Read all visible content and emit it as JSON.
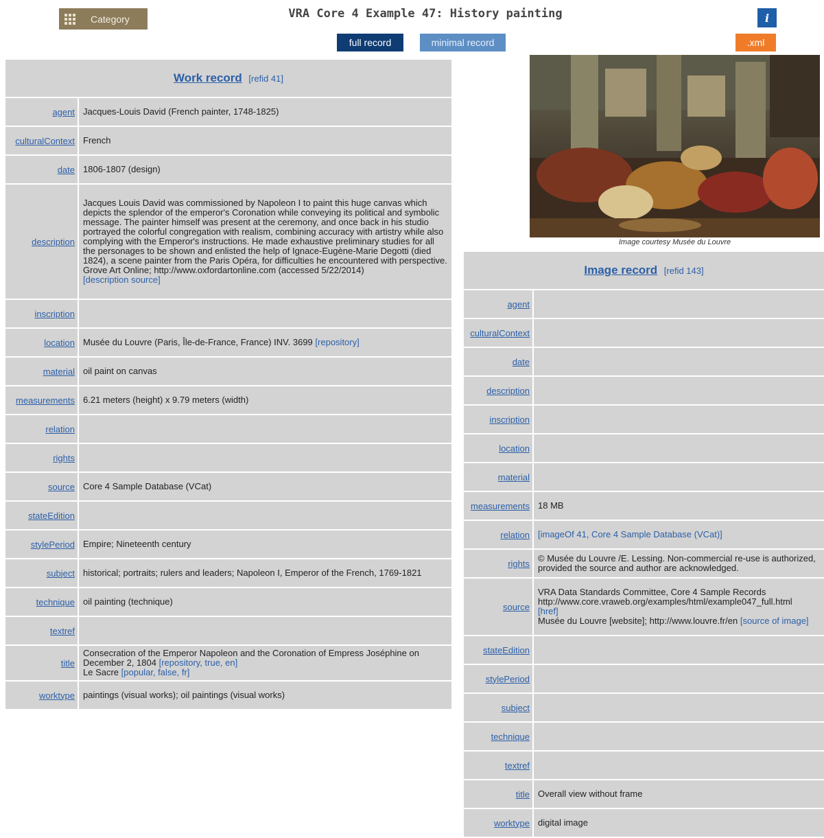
{
  "header": {
    "category_label": "Category",
    "title": "VRA Core 4 Example 47: History painting",
    "info_icon": "i",
    "full_record_label": "full record",
    "minimal_record_label": "minimal record",
    "xml_label": ".xml"
  },
  "work": {
    "title": "Work record",
    "refid": "[refid 41]",
    "agent_label": "agent",
    "agent_value": "Jacques-Louis David (French painter, 1748-1825)",
    "culturalContext_label": "culturalContext",
    "culturalContext_value": "French",
    "date_label": "date",
    "date_value": "1806-1807 (design)",
    "description_label": "description",
    "description_value": "Jacques Louis David was commissioned by Napoleon I to paint this huge canvas which depicts the splendor of the emperor's Coronation while conveying its political and symbolic message. The painter himself was present at the ceremony, and once back in his studio portrayed the colorful congregation with realism, combining accuracy with artistry while also complying with the Emperor's instructions. He made exhaustive preliminary studies for all the personages to be shown and enlisted the help of Ignace-Eugène-Marie Degotti (died 1824), a scene painter from the Paris Opéra, for difficulties he encountered with perspective.",
    "description_source_text": "Grove Art Online; http://www.oxfordartonline.com (accessed 5/22/2014)",
    "description_source_link": "[description source]",
    "inscription_label": "inscription",
    "location_label": "location",
    "location_value": "Musée du Louvre (Paris, Île-de-France, France) INV. 3699",
    "location_link": "[repository]",
    "material_label": "material",
    "material_value": "oil paint on canvas",
    "measurements_label": "measurements",
    "measurements_value": "6.21 meters (height) x 9.79 meters (width)",
    "relation_label": "relation",
    "rights_label": "rights",
    "source_label": "source",
    "source_value": "Core 4 Sample Database (VCat)",
    "stateEdition_label": "stateEdition",
    "stylePeriod_label": "stylePeriod",
    "stylePeriod_value": "Empire; Nineteenth century",
    "subject_label": "subject",
    "subject_value": "historical; portraits; rulers and leaders; Napoleon I, Emperor of the French, 1769-1821",
    "technique_label": "technique",
    "technique_value": "oil painting (technique)",
    "textref_label": "textref",
    "title_label": "title",
    "title_value_1": "Consecration of the Emperor Napoleon and the Coronation of Empress Joséphine on December 2, 1804",
    "title_link_1": "[repository, true, en]",
    "title_value_2": "Le Sacre",
    "title_link_2": "[popular, false, fr]",
    "worktype_label": "worktype",
    "worktype_value": "paintings (visual works); oil paintings (visual works)"
  },
  "image": {
    "caption": "Image courtesy Musée du Louvre",
    "title": "Image record",
    "refid": "[refid 143]",
    "agent_label": "agent",
    "culturalContext_label": "culturalContext",
    "date_label": "date",
    "description_label": "description",
    "inscription_label": "inscription",
    "location_label": "location",
    "material_label": "material",
    "measurements_label": "measurements",
    "measurements_value": "18 MB",
    "relation_label": "relation",
    "relation_value": "[imageOf 41, Core 4 Sample Database (VCat)]",
    "rights_label": "rights",
    "rights_value": "© Musée du Louvre /E. Lessing. Non-commercial re-use is authorized, provided the source and author are acknowledged.",
    "source_label": "source",
    "source_value_1": "VRA Data Standards Committee, Core 4 Sample Records http://www.core.vraweb.org/examples/html/example047_full.html",
    "source_link_1": "[href]",
    "source_value_2": "Musée du Louvre [website]; http://www.louvre.fr/en",
    "source_link_2": "[source of image]",
    "stateEdition_label": "stateEdition",
    "stylePeriod_label": "stylePeriod",
    "subject_label": "subject",
    "technique_label": "technique",
    "textref_label": "textref",
    "title_label": "title",
    "title_value": "Overall view without frame",
    "worktype_label": "worktype",
    "worktype_value": "digital image"
  }
}
